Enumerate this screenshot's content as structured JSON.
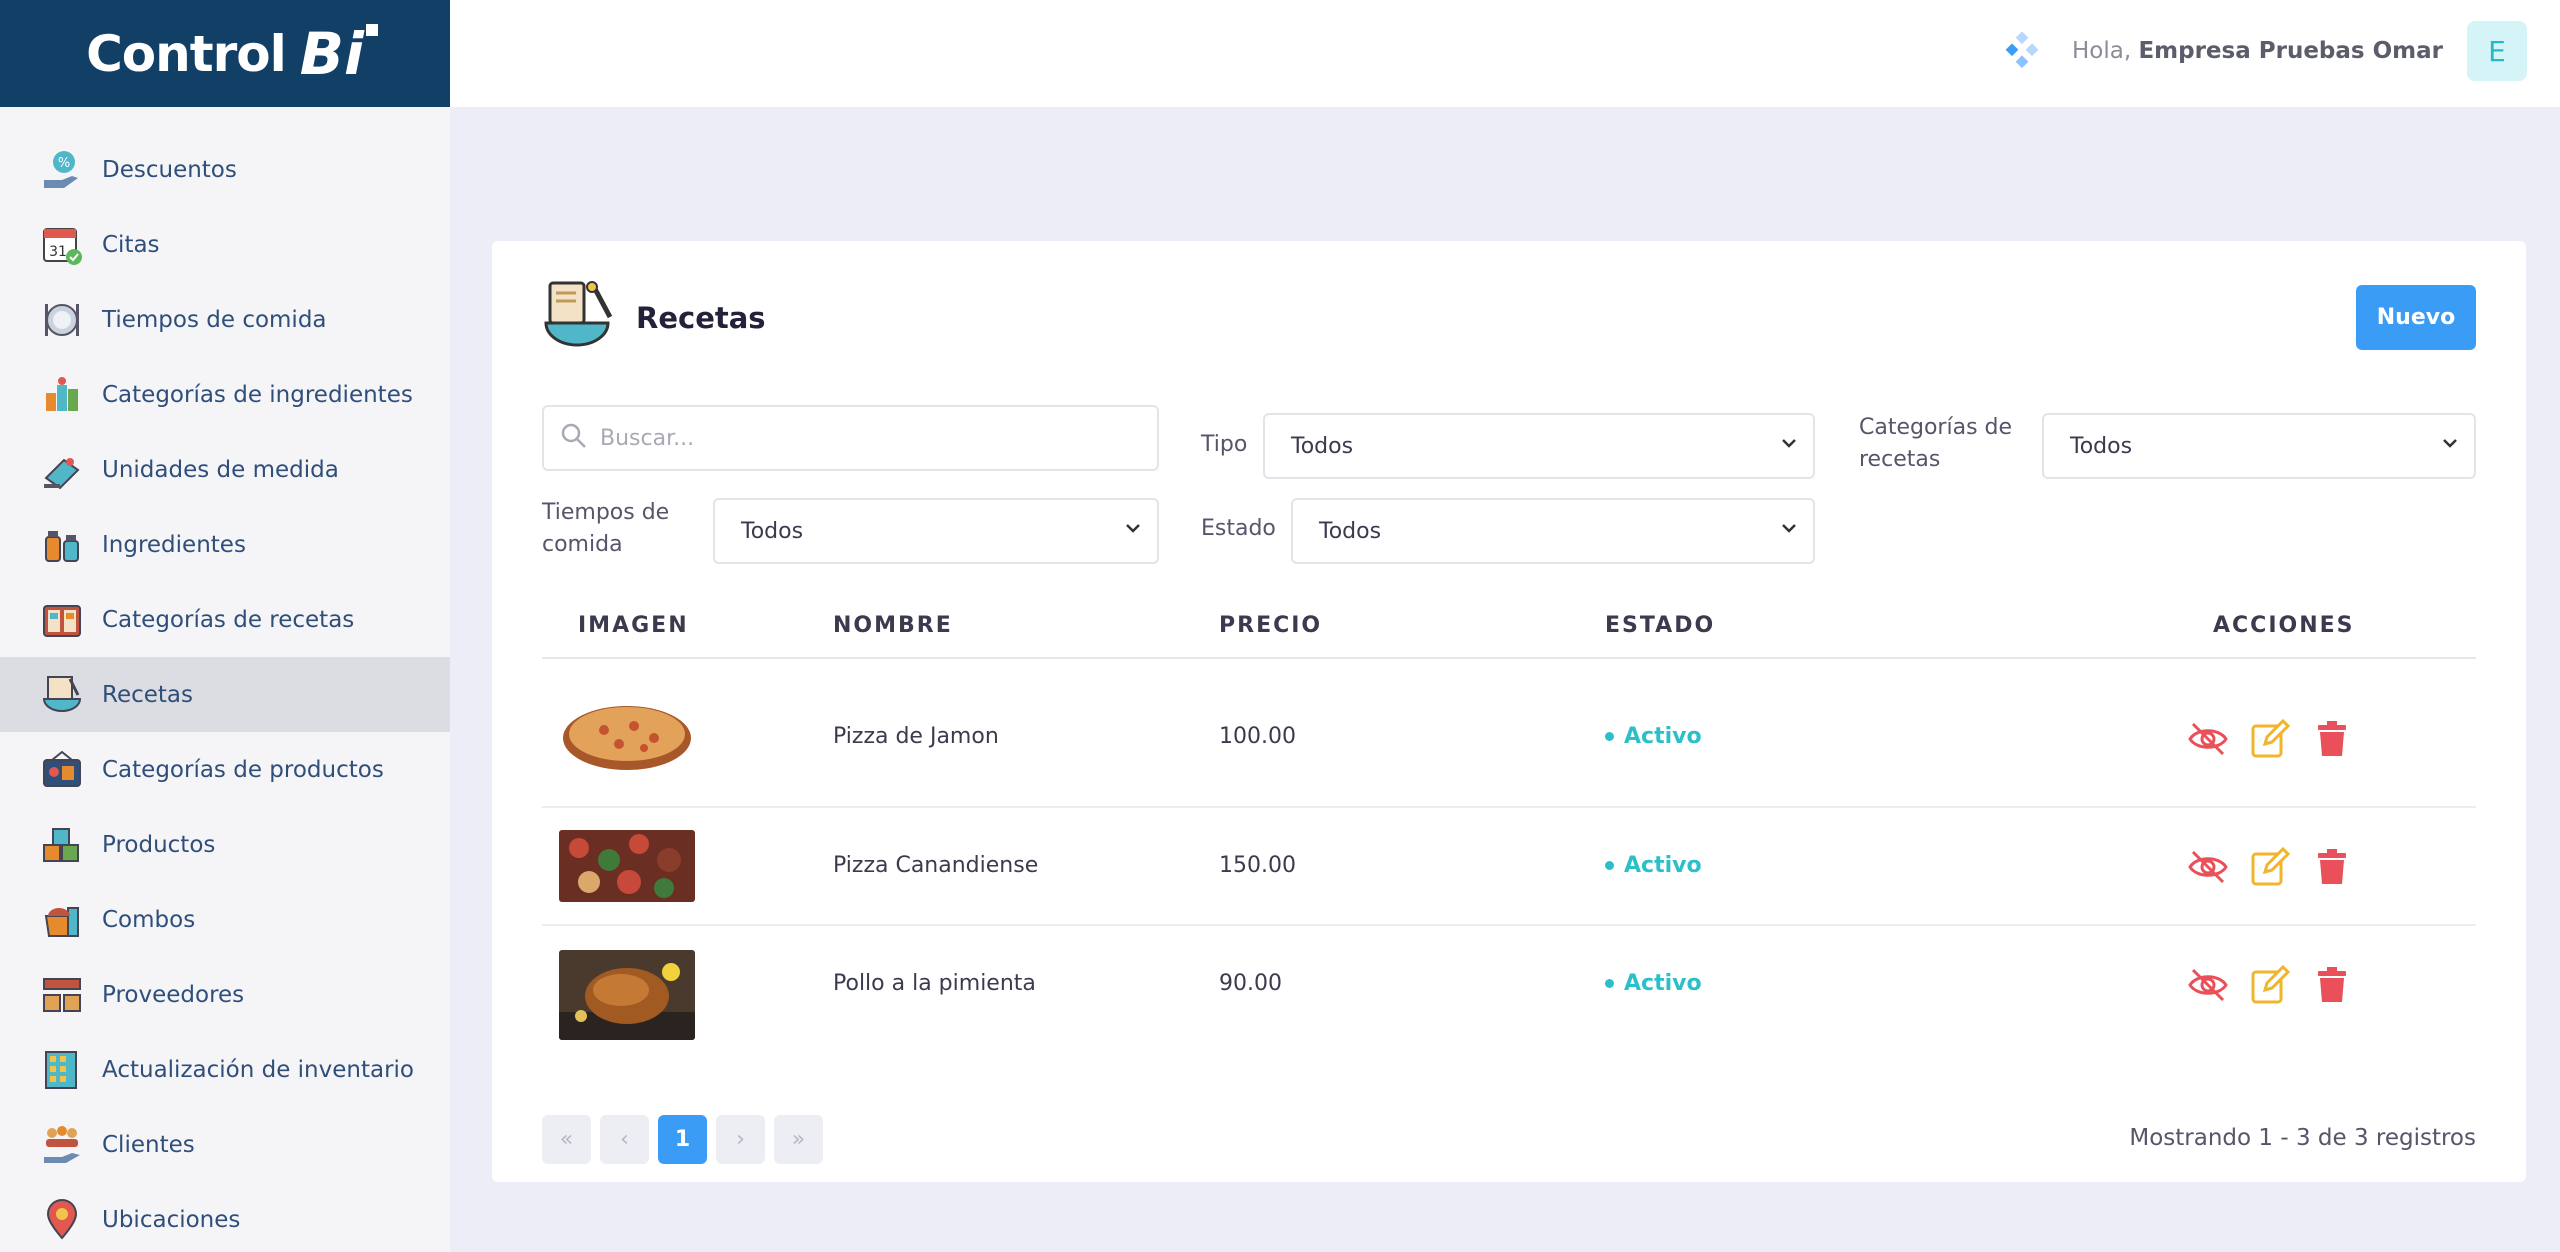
{
  "brand": {
    "text": "Control",
    "bi": "Bi"
  },
  "sidebar": {
    "items": [
      {
        "label": "Descuentos",
        "icon": "discount-hand-icon"
      },
      {
        "label": "Citas",
        "icon": "calendar-check-icon"
      },
      {
        "label": "Tiempos de comida",
        "icon": "plate-cutlery-icon"
      },
      {
        "label": "Categorías de ingredientes",
        "icon": "ingredient-categories-icon"
      },
      {
        "label": "Unidades de medida",
        "icon": "scale-icon"
      },
      {
        "label": "Ingredientes",
        "icon": "jars-icon"
      },
      {
        "label": "Categorías de recetas",
        "icon": "recipe-book-icon"
      },
      {
        "label": "Recetas",
        "icon": "recipe-bowl-icon",
        "active": true
      },
      {
        "label": "Categorías de productos",
        "icon": "product-categories-icon"
      },
      {
        "label": "Productos",
        "icon": "products-icon"
      },
      {
        "label": "Combos",
        "icon": "combo-icon"
      },
      {
        "label": "Proveedores",
        "icon": "supplier-boxes-icon"
      },
      {
        "label": "Actualización de inventario",
        "icon": "inventory-building-icon"
      },
      {
        "label": "Clientes",
        "icon": "clients-hand-icon"
      },
      {
        "label": "Ubicaciones",
        "icon": "location-pin-icon"
      }
    ]
  },
  "topbar": {
    "greeting": "Hola,",
    "user_name": "Empresa Pruebas Omar",
    "avatar_letter": "E"
  },
  "page": {
    "title": "Recetas",
    "new_button": "Nuevo"
  },
  "filters": {
    "search_placeholder": "Buscar...",
    "tipo": {
      "label": "Tipo",
      "value": "Todos"
    },
    "categorias": {
      "label_line1": "Categorías de",
      "label_line2": "recetas",
      "value": "Todos"
    },
    "tiempos": {
      "label_line1": "Tiempos de",
      "label_line2": "comida",
      "value": "Todos"
    },
    "estado": {
      "label": "Estado",
      "value": "Todos"
    }
  },
  "table": {
    "headers": {
      "imagen": "IMAGEN",
      "nombre": "NOMBRE",
      "precio": "PRECIO",
      "estado": "ESTADO",
      "acciones": "ACCIONES"
    },
    "rows": [
      {
        "nombre": "Pizza de Jamon",
        "precio": "100.00",
        "estado": "Activo",
        "image": "pizza-whole"
      },
      {
        "nombre": "Pizza Canandiense",
        "precio": "150.00",
        "estado": "Activo",
        "image": "pizza-slices"
      },
      {
        "nombre": "Pollo a la pimienta",
        "precio": "90.00",
        "estado": "Activo",
        "image": "roast-chicken"
      }
    ]
  },
  "pagination": {
    "first": "«",
    "prev": "‹",
    "current": "1",
    "next": "›",
    "last": "»",
    "summary": "Mostrando 1 - 3 de 3 registros"
  },
  "colors": {
    "brand_dark": "#123f66",
    "accent_blue": "#3b9cf5",
    "status_teal": "#2bc0c9",
    "action_red": "#e9505a",
    "action_yellow": "#f0b52a"
  }
}
